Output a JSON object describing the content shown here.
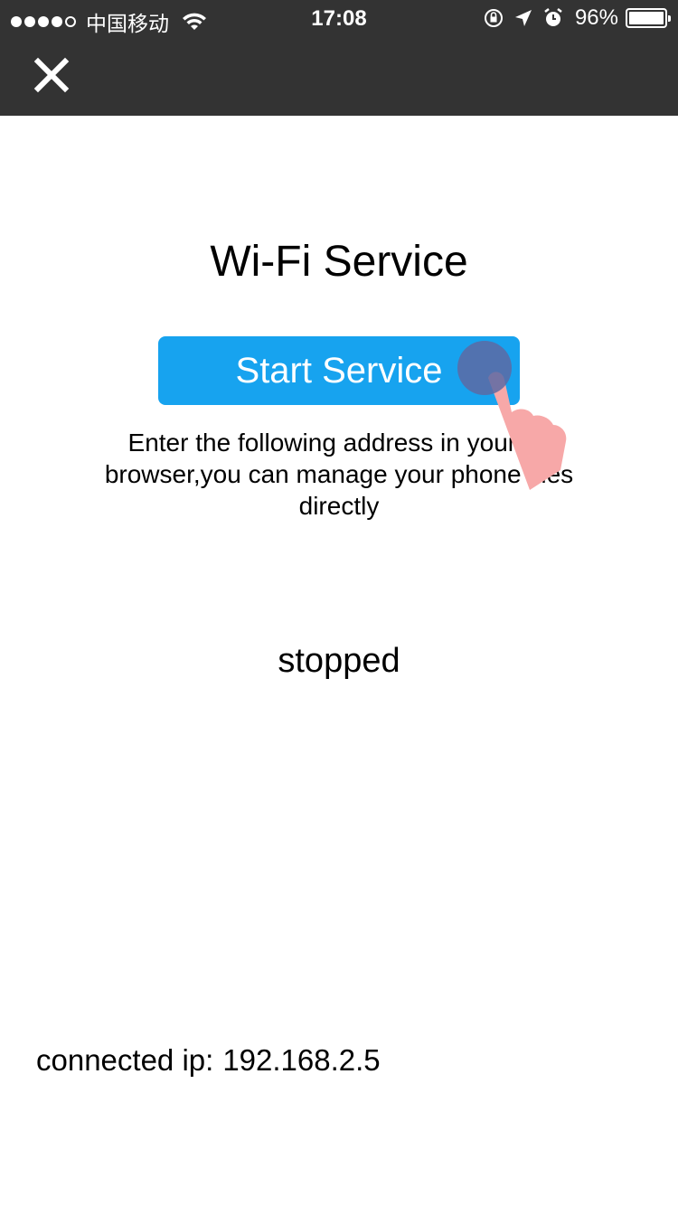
{
  "status_bar": {
    "carrier": "中国移动",
    "time": "17:08",
    "battery": "96%"
  },
  "nav": {
    "close_icon": "close-icon"
  },
  "main": {
    "title": "Wi-Fi Service",
    "start_button": "Start Service",
    "description": "Enter the following address in your pc browser,you can manage your phone files directly",
    "status": "stopped",
    "ip_label": "connected ip:",
    "ip_value": "192.168.2.5"
  },
  "colors": {
    "topbar": "#333333",
    "button": "#17a3ef"
  }
}
